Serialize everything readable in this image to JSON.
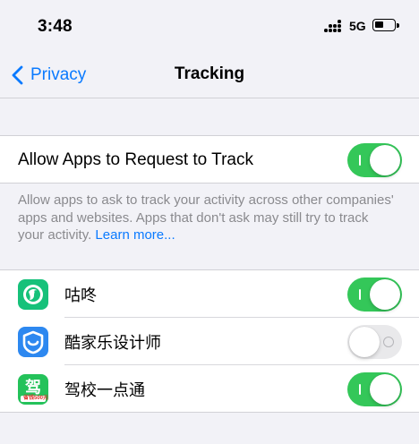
{
  "status_bar": {
    "time": "3:48",
    "network": "5G"
  },
  "nav": {
    "back_label": "Privacy",
    "title": "Tracking"
  },
  "tracking": {
    "label": "Allow Apps to Request to Track",
    "enabled": true
  },
  "footer": {
    "text": "Allow apps to ask to track your activity across other companies' apps and websites. Apps that don't ask may still try to track your activity. ",
    "link": "Learn more..."
  },
  "apps": [
    {
      "name": "咕咚",
      "icon": "gudong-app-icon",
      "enabled": true
    },
    {
      "name": "酷家乐设计师",
      "icon": "kujiale-app-icon",
      "enabled": false
    },
    {
      "name": "驾校一点通",
      "icon": "jiaxiao-app-icon",
      "enabled": true,
      "icon_glyph": "驾",
      "icon_badge": "省钱500元"
    }
  ],
  "colors": {
    "accent": "#0a7aff",
    "toggle_on": "#34c759",
    "toggle_off": "#e9e9eb",
    "background": "#f2f2f7"
  }
}
